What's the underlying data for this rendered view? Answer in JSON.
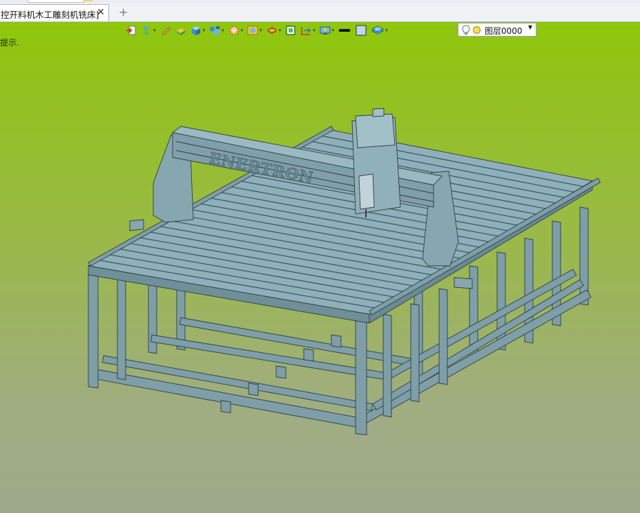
{
  "tabs": [
    {
      "title": "控开料机木工雕刻机铣床]",
      "close_icon": "close-icon"
    }
  ],
  "new_tab_icon": "plus-icon",
  "canvas": {
    "hint_text": "提示.",
    "background_top": "#8ec70b",
    "background_bottom": "#9faa8c",
    "model_color": "#7e9ea8",
    "gantry_lettering": "ENERTRON"
  },
  "toolbar": {
    "items": [
      {
        "icon": "import-icon",
        "dropdown": false
      },
      {
        "icon": "shape-paint-icon",
        "dropdown": true
      },
      {
        "icon": "pencil-icon",
        "dropdown": false
      },
      {
        "icon": "solid-block-icon",
        "dropdown": false
      },
      {
        "icon": "cube-view-icon",
        "dropdown": true
      },
      {
        "icon": "components-icon",
        "dropdown": true
      },
      {
        "icon": "render-mode-icon",
        "dropdown": true
      },
      {
        "icon": "display-filter-icon",
        "dropdown": true
      },
      {
        "icon": "rotate-view-icon",
        "dropdown": true
      },
      {
        "icon": "fit-view-icon",
        "dropdown": false
      },
      {
        "icon": "measure-icon",
        "dropdown": true
      },
      {
        "icon": "display-settings-icon",
        "dropdown": true
      },
      {
        "icon": "line-color-icon",
        "dropdown": false
      },
      {
        "icon": "fill-color-icon",
        "dropdown": false
      },
      {
        "icon": "layer-stack-icon",
        "dropdown": true
      }
    ],
    "layer_select": {
      "value": "图层0000",
      "bulb_icon": "lightbulb-icon",
      "state_icon": "layer-on-icon"
    }
  }
}
